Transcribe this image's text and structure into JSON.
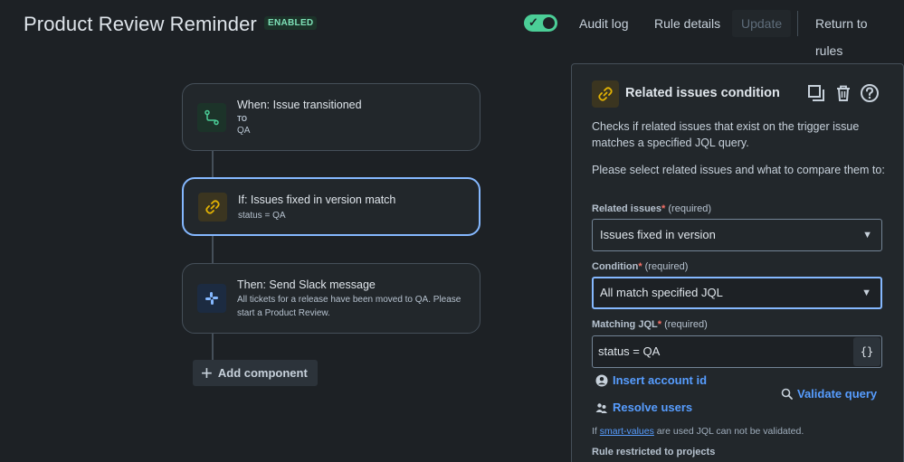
{
  "header": {
    "title": "Product Review Reminder",
    "badge": "ENABLED",
    "toggle_state": "on",
    "audit_log": "Audit log",
    "rule_details": "Rule details",
    "update": "Update",
    "return_to_rules": "Return to rules"
  },
  "flow": {
    "trigger": {
      "title": "When: Issue transitioned",
      "to_label": "TO",
      "status": "QA",
      "icon": "branch-icon"
    },
    "condition": {
      "title": "If: Issues fixed in version match",
      "subtitle": "status = QA",
      "icon": "link-icon"
    },
    "action": {
      "title": "Then: Send Slack message",
      "subtitle": "All tickets for a release have been moved to QA. Please start a Product Review.",
      "icon": "slack-icon"
    },
    "add_component": "Add component"
  },
  "panel": {
    "title": "Related issues condition",
    "description": "Checks if related issues that exist on the trigger issue matches a specified JQL query.",
    "instruction": "Please select related issues and what to compare them to:",
    "related_issues": {
      "label": "Related issues",
      "required": "(required)",
      "value": "Issues fixed in version"
    },
    "condition": {
      "label": "Condition",
      "required": "(required)",
      "value": "All match specified JQL"
    },
    "matching_jql": {
      "label": "Matching JQL",
      "required": "(required)",
      "value": "status = QA",
      "button": "{}"
    },
    "insert_account_id": "Insert account id",
    "resolve_users": "Resolve users",
    "validate_query": "Validate query",
    "hint_prefix": "If ",
    "hint_link": "smart-values",
    "hint_suffix": " are used JQL can not be validated.",
    "restricted_title": "Rule restricted to projects"
  },
  "colors": {
    "background": "#1d2125",
    "accent_blue": "#85b8ff",
    "link_blue": "#579dff",
    "toggle_green": "#4bce97",
    "required_red": "#f87168"
  }
}
